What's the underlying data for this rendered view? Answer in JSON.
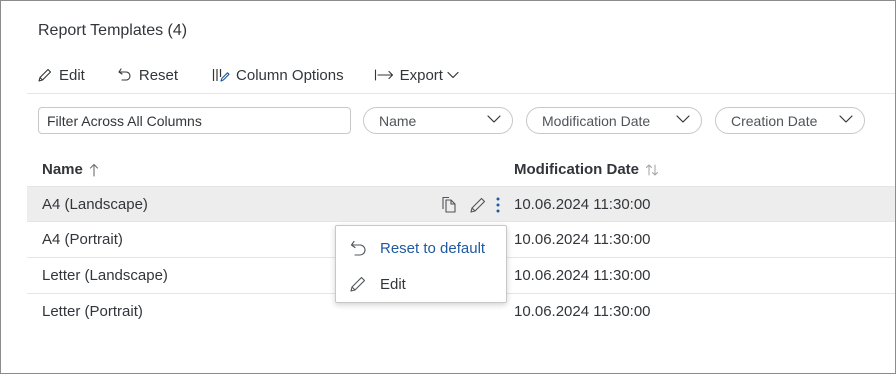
{
  "header": {
    "title": "Report Templates (4)"
  },
  "toolbar": {
    "edit_label": "Edit",
    "reset_label": "Reset",
    "column_options_label": "Column Options",
    "export_label": "Export"
  },
  "filters": {
    "search_placeholder": "Filter Across All Columns",
    "name_label": "Name",
    "modification_date_label": "Modification Date",
    "creation_date_label": "Creation Date"
  },
  "table": {
    "columns": {
      "name": "Name",
      "modification_date": "Modification Date"
    },
    "rows": [
      {
        "name": "A4 (Landscape)",
        "modified": "10.06.2024 11:30:00"
      },
      {
        "name": "A4 (Portrait)",
        "modified": "10.06.2024 11:30:00"
      },
      {
        "name": "Letter (Landscape)",
        "modified": "10.06.2024 11:30:00"
      },
      {
        "name": "Letter (Portrait)",
        "modified": "10.06.2024 11:30:00"
      }
    ]
  },
  "context_menu": {
    "items": [
      {
        "label": "Reset to default",
        "icon": "undo-icon"
      },
      {
        "label": "Edit",
        "icon": "pencil-icon"
      }
    ]
  },
  "colors": {
    "text": "#32363a",
    "link": "#1f5aa0",
    "selected_row": "#ededed",
    "border": "#c8c8c8"
  }
}
